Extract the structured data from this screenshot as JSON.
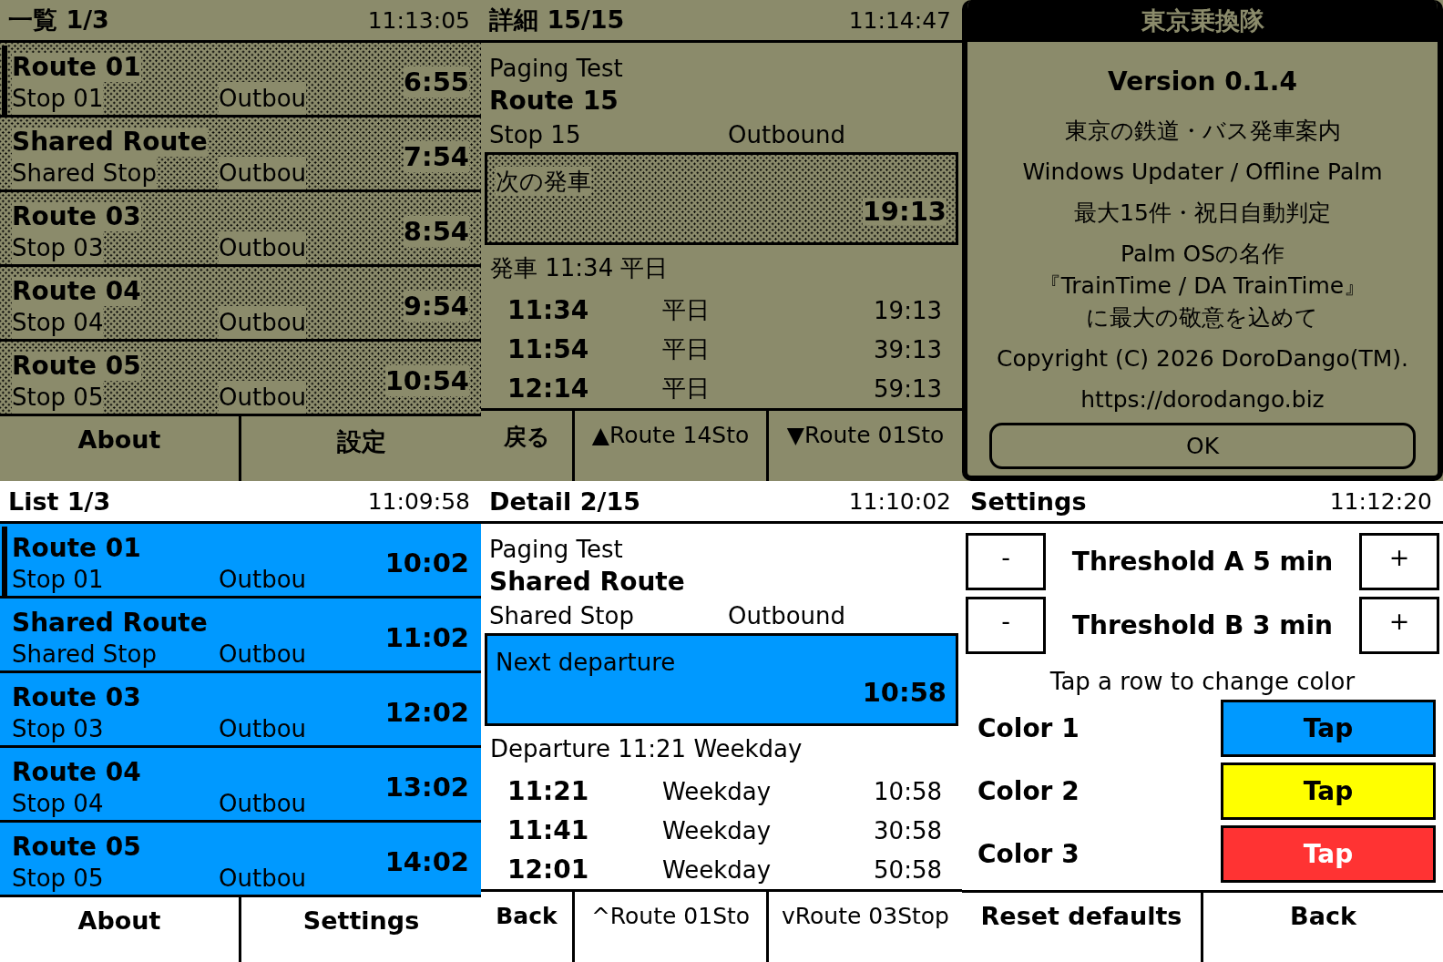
{
  "screens": [
    {
      "kind": "list",
      "monochrome": true,
      "title": "一覧 1/3",
      "clock": "11:13:05",
      "rows": [
        {
          "route": "Route 01",
          "stop": "Stop 01",
          "direction": "Outbou",
          "time": "6:55",
          "selected": true
        },
        {
          "route": "Shared Route",
          "stop": "Shared Stop",
          "direction": "Outbou",
          "time": "7:54",
          "selected": false
        },
        {
          "route": "Route 03",
          "stop": "Stop 03",
          "direction": "Outbou",
          "time": "8:54",
          "selected": false
        },
        {
          "route": "Route 04",
          "stop": "Stop 04",
          "direction": "Outbou",
          "time": "9:54",
          "selected": false
        },
        {
          "route": "Route 05",
          "stop": "Stop 05",
          "direction": "Outbou",
          "time": "10:54",
          "selected": false
        }
      ],
      "buttons": [
        "About",
        "設定"
      ]
    },
    {
      "kind": "detail",
      "monochrome": true,
      "title": "詳細 15/15",
      "clock": "11:14:47",
      "line": "Paging Test",
      "route": "Route 15",
      "stop": "Stop 15",
      "direction": "Outbound",
      "next_departure": {
        "label": "次の発車",
        "time": "19:13"
      },
      "summary": "発車 11:34 平日",
      "departures": [
        {
          "time": "11:34",
          "day": "平日",
          "countdown": "19:13"
        },
        {
          "time": "11:54",
          "day": "平日",
          "countdown": "39:13"
        },
        {
          "time": "12:14",
          "day": "平日",
          "countdown": "59:13"
        }
      ],
      "buttons": [
        "戻る",
        "▲Route 14Sto",
        "▼Route 01Sto"
      ]
    },
    {
      "kind": "about",
      "monochrome": true,
      "title": "東京乗換隊",
      "version": "Version 0.1.4",
      "paragraphs": [
        [
          "東京の鉄道・バス発車案内"
        ],
        [
          "Windows Updater / Offline Palm"
        ],
        [
          "最大15件・祝日自動判定"
        ],
        [
          "Palm OSの名作",
          "『TrainTime / DA TrainTime』",
          "に最大の敬意を込めて"
        ],
        [
          "Copyright (C) 2026 DoroDango(TM)."
        ],
        [
          "https://dorodango.biz"
        ]
      ],
      "button": "OK"
    },
    {
      "kind": "list",
      "monochrome": false,
      "title": "List 1/3",
      "clock": "11:09:58",
      "rows": [
        {
          "route": "Route 01",
          "stop": "Stop 01",
          "direction": "Outbou",
          "time": "10:02",
          "selected": true
        },
        {
          "route": "Shared Route",
          "stop": "Shared Stop",
          "direction": "Outbou",
          "time": "11:02",
          "selected": false
        },
        {
          "route": "Route 03",
          "stop": "Stop 03",
          "direction": "Outbou",
          "time": "12:02",
          "selected": false
        },
        {
          "route": "Route 04",
          "stop": "Stop 04",
          "direction": "Outbou",
          "time": "13:02",
          "selected": false
        },
        {
          "route": "Route 05",
          "stop": "Stop 05",
          "direction": "Outbou",
          "time": "14:02",
          "selected": false
        }
      ],
      "buttons": [
        "About",
        "Settings"
      ]
    },
    {
      "kind": "detail",
      "monochrome": false,
      "title": "Detail 2/15",
      "clock": "11:10:02",
      "line": "Paging Test",
      "route": "Shared Route",
      "stop": "Shared Stop",
      "direction": "Outbound",
      "next_departure": {
        "label": "Next departure",
        "time": "10:58"
      },
      "summary": "Departure 11:21 Weekday",
      "departures": [
        {
          "time": "11:21",
          "day": "Weekday",
          "countdown": "10:58"
        },
        {
          "time": "11:41",
          "day": "Weekday",
          "countdown": "30:58"
        },
        {
          "time": "12:01",
          "day": "Weekday",
          "countdown": "50:58"
        }
      ],
      "buttons": [
        "Back",
        "^Route 01Sto",
        "vRoute 03Stop"
      ]
    },
    {
      "kind": "settings",
      "monochrome": false,
      "title": "Settings",
      "clock": "11:12:20",
      "thresholds": [
        {
          "minus": "-",
          "label": "Threshold A 5 min",
          "plus": "+"
        },
        {
          "minus": "-",
          "label": "Threshold B 3 min",
          "plus": "+"
        }
      ],
      "hint": "Tap a row to change color",
      "colors": [
        {
          "label": "Color 1",
          "button": "Tap",
          "color": "#0099ff"
        },
        {
          "label": "Color 2",
          "button": "Tap",
          "color": "#ffff00"
        },
        {
          "label": "Color 3",
          "button": "Tap",
          "color": "#ff3333"
        }
      ],
      "buttons": [
        "Reset defaults",
        "Back"
      ]
    }
  ]
}
